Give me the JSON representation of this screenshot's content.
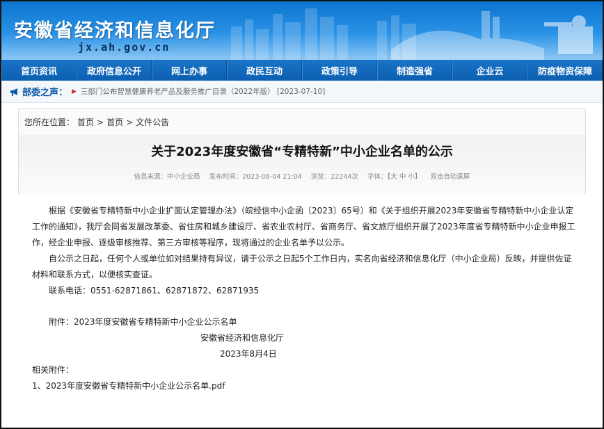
{
  "header": {
    "title": "安徽省经济和信息化厅",
    "domain": "jx.ah.gov.cn"
  },
  "nav": [
    {
      "label": "首页资讯"
    },
    {
      "label": "政府信息公开"
    },
    {
      "label": "网上办事"
    },
    {
      "label": "政民互动"
    },
    {
      "label": "政策引导"
    },
    {
      "label": "制造强省"
    },
    {
      "label": "企业云"
    },
    {
      "label": "防疫物资保障"
    }
  ],
  "notice": {
    "label": "部委之声：",
    "arrow": "▶",
    "text": "三部门公布智慧健康养老产品及服务推广目录（2022年版）  [2023-07-10]"
  },
  "breadcrumb": {
    "prefix": "您所在位置：",
    "items": [
      "首页",
      "首页",
      "文件公告"
    ],
    "separator": ">"
  },
  "article": {
    "title": "关于2023年度安徽省“专精特新”中小企业名单的公示",
    "meta": {
      "source": "信息来源：中小企业局",
      "date": "发布时间：2023-08-04 21:04",
      "views": "浏览：22244次",
      "font_label": "字体：【",
      "font_large": "大",
      "font_medium": "中",
      "font_small": "小",
      "font_end": "】",
      "autoscroll": "双击自动滚屏"
    },
    "paragraphs": [
      "根据《安徽省专精特新中小企业扩面认定管理办法》（皖经信中小企函〔2023〕65号）和《关于组织开展2023年安徽省专精特新中小企业认定工作的通知》，我厅会同省发展改革委、省住房和城乡建设厅、省农业农村厅、省商务厅、省文旅厅组织开展了2023年度省专精特新中小企业申报工作，经企业申报、逐级审核推荐、第三方审核等程序，现将通过的企业名单予以公示。",
      "自公示之日起，任何个人或单位如对结果持有异议，请于公示之日起5个工作日内，实名向省经济和信息化厅（中小企业局）反映，并提供佐证材料和联系方式，以便核实查证。",
      "联系电话：0551-62871861、62871872、62871935"
    ],
    "attachment_note": "附件：2023年度安徽省专精特新中小企业公示名单",
    "signature_org": "安徽省经济和信息化厅",
    "signature_date": "2023年8月4日",
    "related_label": "相关附件：",
    "related_files": [
      "1、2023年度安徽省专精特新中小企业公示名单.pdf"
    ]
  },
  "icons": {
    "notice": "bullhorn-icon"
  },
  "colors": {
    "header_top": "#0a74cf",
    "nav_bg": "#0c5fb0",
    "notice_label": "#0d57a8"
  }
}
